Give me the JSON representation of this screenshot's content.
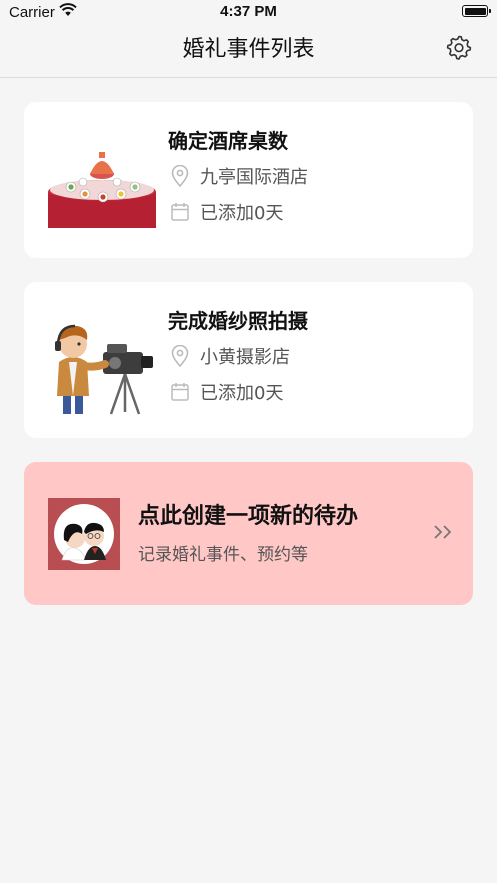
{
  "status_bar": {
    "carrier": "Carrier",
    "time": "4:37 PM"
  },
  "nav": {
    "title": "婚礼事件列表",
    "settings_icon": "gear-icon"
  },
  "events": [
    {
      "title": "确定酒席桌数",
      "location": "九亭国际酒店",
      "added": "已添加0天",
      "image": "banquet-table-illustration"
    },
    {
      "title": "完成婚纱照拍摄",
      "location": "小黄摄影店",
      "added": "已添加0天",
      "image": "cameraman-illustration"
    }
  ],
  "create": {
    "title": "点此创建一项新的待办",
    "subtitle": "记录婚礼事件、预约等",
    "image": "couple-illustration",
    "arrow_icon": "double-chevron-right-icon",
    "background": "#ffc8c7"
  },
  "colors": {
    "background": "#f5f5f5",
    "card": "#ffffff",
    "muted_text": "#555555"
  }
}
